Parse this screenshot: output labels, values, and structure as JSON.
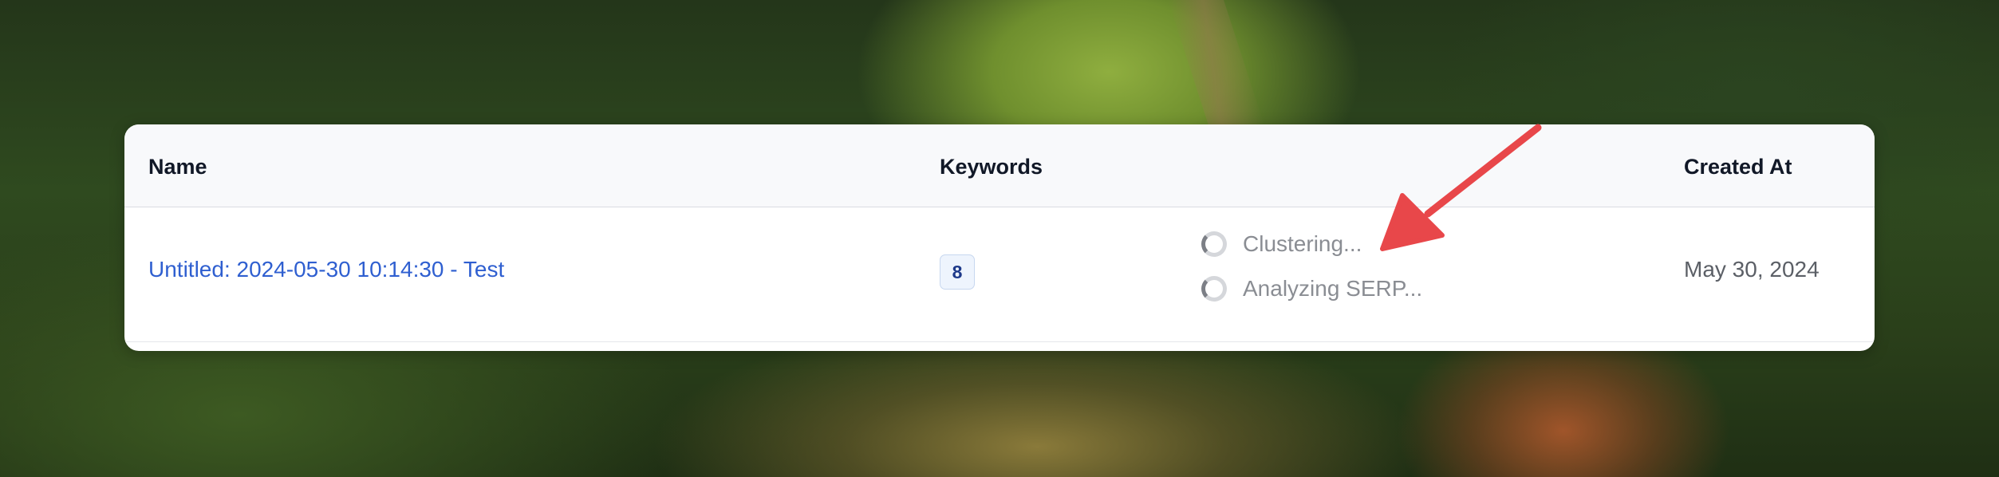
{
  "table": {
    "headers": {
      "name": "Name",
      "keywords": "Keywords",
      "created_at": "Created At"
    },
    "rows": [
      {
        "name": "Untitled: 2024-05-30 10:14:30 - Test",
        "keywords_count": "8",
        "statuses": [
          {
            "label": "Clustering...",
            "icon": "spinner-icon"
          },
          {
            "label": "Analyzing SERP...",
            "icon": "spinner-icon"
          }
        ],
        "created_at": "May 30, 2024"
      }
    ]
  },
  "annotation": {
    "arrow_icon": "arrow-icon",
    "color": "#e8474a"
  },
  "colors": {
    "link": "#2f5fd0",
    "header_bg": "#f8f9fb",
    "badge_bg": "#eef4fd"
  }
}
